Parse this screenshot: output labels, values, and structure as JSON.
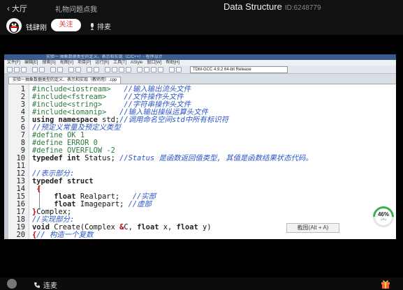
{
  "header": {
    "back_label": "大厅",
    "gift_link": "礼物问题点我",
    "room_title": "Data Structure",
    "room_id": "ID:6248779"
  },
  "streamer": {
    "name": "钱肆刚",
    "follow_label": "关注",
    "rank_label": "排麦"
  },
  "ide": {
    "window_title": "实验一   抽象数据类型的定义、表示和实现（C/C++）- 程序设计",
    "menu": [
      "文件[F]",
      "编辑[E]",
      "搜索[S]",
      "视图[V]",
      "项目[P]",
      "运行[R]",
      "工具[T]",
      "AStyle",
      "窗口[W]",
      "帮助[H]"
    ],
    "compiler": "TDM-GCC 4.9.2 64-bit Release",
    "file_tab": "实验一抽象数据类型的定义、表示和实现（教师用）.cpp",
    "lines": [
      {
        "n": "1",
        "segs": [
          {
            "c": "pp",
            "t": "#include"
          },
          {
            "c": "hdr",
            "t": "<iostream>"
          },
          {
            "c": "",
            "t": "   "
          },
          {
            "c": "cm",
            "t": "//输入输出流头文件"
          }
        ]
      },
      {
        "n": "2",
        "segs": [
          {
            "c": "pp",
            "t": "#include"
          },
          {
            "c": "hdr",
            "t": "<fstream>"
          },
          {
            "c": "",
            "t": "    "
          },
          {
            "c": "cm",
            "t": "//文件操作头文件"
          }
        ]
      },
      {
        "n": "3",
        "segs": [
          {
            "c": "pp",
            "t": "#include"
          },
          {
            "c": "hdr",
            "t": "<string>"
          },
          {
            "c": "",
            "t": "     "
          },
          {
            "c": "cm",
            "t": "//字符串操作头文件"
          }
        ]
      },
      {
        "n": "4",
        "segs": [
          {
            "c": "pp",
            "t": "#include"
          },
          {
            "c": "hdr",
            "t": "<iomanip>"
          },
          {
            "c": "",
            "t": "   "
          },
          {
            "c": "cm",
            "t": "//输入输出操纵运算头文件"
          }
        ]
      },
      {
        "n": "5",
        "segs": [
          {
            "c": "kw",
            "t": "using namespace"
          },
          {
            "c": "",
            "t": " std;"
          },
          {
            "c": "cm",
            "t": "//调用命名空间std中所有标识符"
          }
        ]
      },
      {
        "n": "6",
        "segs": [
          {
            "c": "cm",
            "t": "//预定义常量及预定义类型"
          }
        ]
      },
      {
        "n": "7",
        "segs": [
          {
            "c": "pp",
            "t": "#define OK 1"
          }
        ]
      },
      {
        "n": "8",
        "segs": [
          {
            "c": "pp",
            "t": "#define ERROR 0"
          }
        ]
      },
      {
        "n": "9",
        "segs": [
          {
            "c": "pp",
            "t": "#define OVERFLOW -2"
          }
        ]
      },
      {
        "n": "10",
        "segs": [
          {
            "c": "kw",
            "t": "typedef int"
          },
          {
            "c": "",
            "t": " Status; "
          },
          {
            "c": "cm",
            "t": "//Status 是函数返回值类型, 其值是函数结果状态代码。"
          }
        ]
      },
      {
        "n": "11",
        "segs": []
      },
      {
        "n": "12",
        "segs": [
          {
            "c": "cm",
            "t": "//表示部分:"
          }
        ]
      },
      {
        "n": "13",
        "segs": [
          {
            "c": "kw",
            "t": "typedef struct"
          }
        ]
      },
      {
        "n": "14",
        "segs": [
          {
            "c": "op",
            "t": " {"
          }
        ]
      },
      {
        "n": "15",
        "segs": [
          {
            "c": "",
            "t": "     "
          },
          {
            "c": "kw",
            "t": "float"
          },
          {
            "c": "",
            "t": " Realpart;   "
          },
          {
            "c": "cm",
            "t": "//实部"
          }
        ]
      },
      {
        "n": "16",
        "segs": [
          {
            "c": "",
            "t": "     "
          },
          {
            "c": "kw",
            "t": "float"
          },
          {
            "c": "",
            "t": " Imagepart; "
          },
          {
            "c": "cm",
            "t": "//虚部"
          }
        ]
      },
      {
        "n": "17",
        "segs": [
          {
            "c": "op",
            "t": "}"
          },
          {
            "c": "",
            "t": "Complex;"
          }
        ]
      },
      {
        "n": "18",
        "segs": [
          {
            "c": "cm",
            "t": "//实现部分:"
          }
        ]
      },
      {
        "n": "19",
        "segs": [
          {
            "c": "kw",
            "t": "void"
          },
          {
            "c": "",
            "t": " Create(Complex "
          },
          {
            "c": "op",
            "t": "&"
          },
          {
            "c": "",
            "t": "C, "
          },
          {
            "c": "kw",
            "t": "float"
          },
          {
            "c": "",
            "t": " x, "
          },
          {
            "c": "kw",
            "t": "float"
          },
          {
            "c": "",
            "t": " y)"
          }
        ]
      },
      {
        "n": "20",
        "segs": [
          {
            "c": "op",
            "t": "{"
          },
          {
            "c": "cm",
            "t": "// 构造一个复数"
          }
        ]
      }
    ],
    "shortcut_tip": "截图(Alt + A)",
    "cpu_value": "46%",
    "cpu_sub": "CPU"
  },
  "footer": {
    "connect_label": "连麦"
  },
  "colors": {
    "follow_text": "#e33333",
    "comment": "#2a55c8",
    "preprocessor": "#2a7a3a",
    "gauge": "#35b34a"
  }
}
